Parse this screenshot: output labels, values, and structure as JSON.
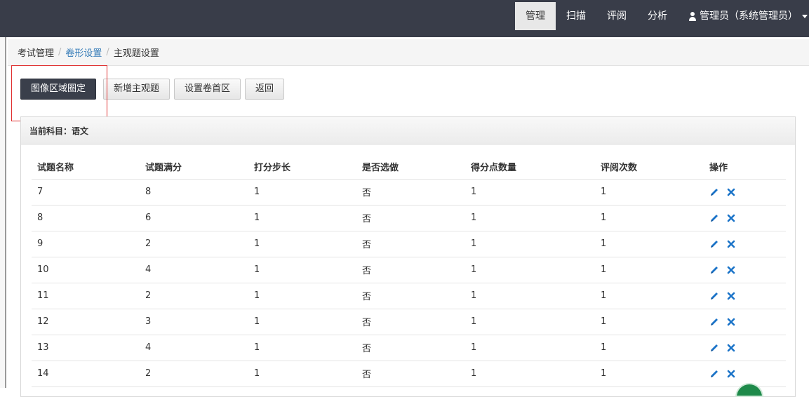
{
  "topnav": {
    "items": [
      {
        "label": "管理",
        "active": true
      },
      {
        "label": "扫描"
      },
      {
        "label": "评阅"
      },
      {
        "label": "分析"
      }
    ],
    "user": "管理员（系统管理员）"
  },
  "breadcrumb": {
    "items": [
      "考试管理",
      "卷形设置",
      "主观题设置"
    ]
  },
  "toolbar": {
    "buttons": [
      "图像区域圈定",
      "新增主观题",
      "设置卷首区",
      "返回"
    ]
  },
  "panel": {
    "title": "当前科目：语文"
  },
  "table": {
    "headers": [
      "试题名称",
      "试题满分",
      "打分步长",
      "是否选做",
      "得分点数量",
      "评阅次数",
      "操作"
    ],
    "rows": [
      [
        "7",
        "8",
        "1",
        "否",
        "1",
        "1"
      ],
      [
        "8",
        "6",
        "1",
        "否",
        "1",
        "1"
      ],
      [
        "9",
        "2",
        "1",
        "否",
        "1",
        "1"
      ],
      [
        "10",
        "4",
        "1",
        "否",
        "1",
        "1"
      ],
      [
        "11",
        "2",
        "1",
        "否",
        "1",
        "1"
      ],
      [
        "12",
        "3",
        "1",
        "否",
        "1",
        "1"
      ],
      [
        "13",
        "4",
        "1",
        "否",
        "1",
        "1"
      ],
      [
        "14",
        "2",
        "1",
        "否",
        "1",
        "1"
      ]
    ]
  },
  "colors": {
    "topbar": "#393d49",
    "link": "#337ab7",
    "icon_blue": "#1a73c8",
    "highlight": "#e03030"
  }
}
